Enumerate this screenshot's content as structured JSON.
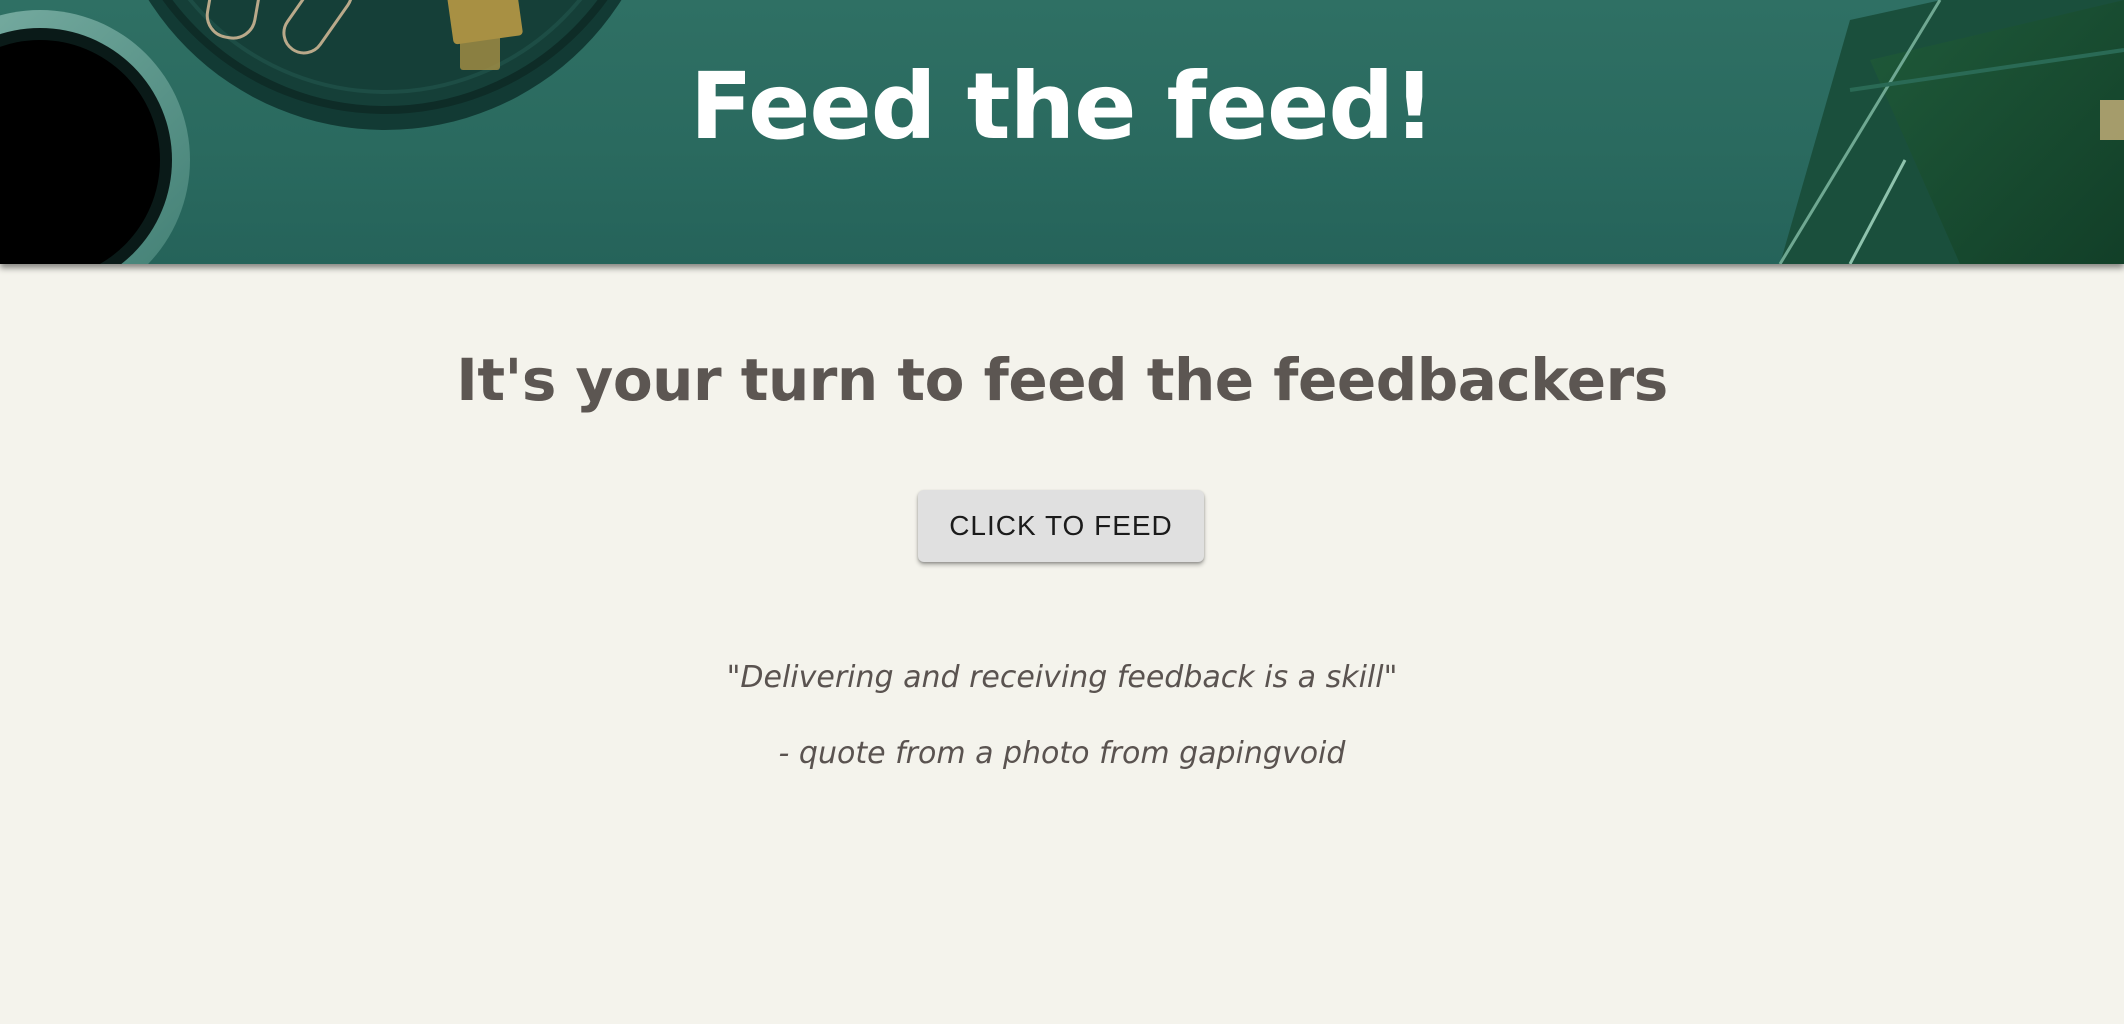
{
  "header": {
    "title": "Feed the feed!",
    "background_color": "#2a6a5f"
  },
  "main": {
    "subtitle": "It's your turn to feed the feedbackers",
    "button_label": "CLICK TO FEED",
    "quote": "\"Delivering and receiving feedback is a skill\"",
    "quote_source": "- quote from a photo from gapingvoid",
    "background_color": "#f4f3ec",
    "text_color": "#5c5652"
  }
}
